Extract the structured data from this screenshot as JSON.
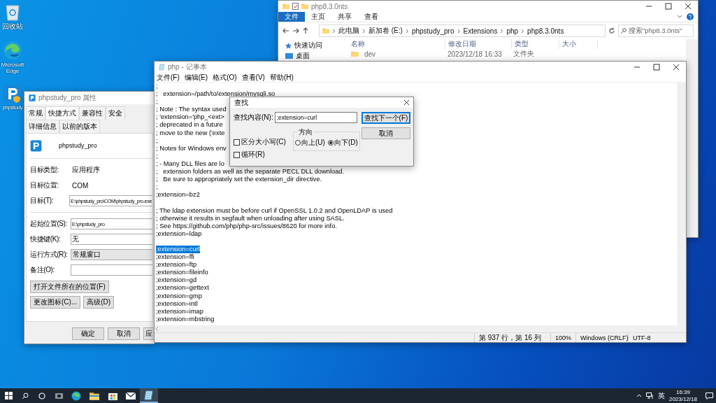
{
  "desktop_icons": [
    {
      "kind": "recycle",
      "label": "回收站"
    },
    {
      "kind": "browser",
      "label": "Microsoft Edge"
    },
    {
      "kind": "app",
      "label": "phpstudy"
    }
  ],
  "explorer": {
    "title": "php8.3.0nts",
    "ribbon_tabs": [
      {
        "label": "文件",
        "selected": true
      },
      {
        "label": "主页",
        "selected": false
      },
      {
        "label": "共享",
        "selected": false
      },
      {
        "label": "查看",
        "selected": false
      }
    ],
    "breadcrumb": [
      "此电脑",
      "新加卷 (E:)",
      "phpstudy_pro",
      "Extensions",
      "php",
      "php8.3.0nts"
    ],
    "search": {
      "placeholder": "搜索\"php8.3.0nts\""
    },
    "sidebar": [
      {
        "label": "快速访问",
        "kind": "star"
      },
      {
        "label": "桌面",
        "kind": "desktop"
      }
    ],
    "columns": [
      "名称",
      "修改日期",
      "类型",
      "大小"
    ],
    "rows": [
      {
        "name": "dev",
        "modified": "2023/12/18 16:33",
        "type": "文件夹"
      }
    ]
  },
  "properties": {
    "title": "phpstudy_pro 属性",
    "tabs": [
      {
        "label": "常规",
        "selected": false
      },
      {
        "label": "快捷方式",
        "selected": true
      },
      {
        "label": "兼容性",
        "selected": false
      },
      {
        "label": "安全",
        "selected": false
      },
      {
        "label": "详细信息",
        "selected": false
      },
      {
        "label": "以前的版本",
        "selected": false
      }
    ],
    "name": "phpstudy_pro",
    "groups": [
      [
        {
          "label": "目标类型:",
          "value": "应用程序",
          "kind": "text"
        },
        {
          "label": "目标位置:",
          "value": "COM",
          "kind": "text"
        },
        {
          "label": "目标(T):",
          "value": "E:\\phpstudy_pro\\COM\\phpstudy_pro.exe",
          "kind": "field"
        }
      ],
      [
        {
          "label": "起始位置(S):",
          "value": "E:\\phpstudy_pro",
          "kind": "field"
        },
        {
          "label": "快捷键(K):",
          "value": "无",
          "kind": "field"
        },
        {
          "label": "运行方式(R):",
          "value": "常规窗口",
          "kind": "dropdown"
        },
        {
          "label": "备注(O):",
          "kind": "field"
        }
      ]
    ],
    "actions": [
      "打开文件所在的位置(F)",
      "更改图标(C)...",
      "高级(D)"
    ],
    "footer_buttons": [
      "确定",
      "取消",
      "应"
    ]
  },
  "notepad": {
    "title": "php - 记事本",
    "menu": [
      "文件(F)",
      "编辑(E)",
      "格式(O)",
      "查看(V)",
      "帮助(H)"
    ],
    "lines": [
      {
        "text": ";",
        "selected": false
      },
      {
        "text": ";   extension=/path/to/extension/mysqli.so",
        "selected": false
      },
      {
        "text": ";",
        "selected": false
      },
      {
        "text": "; Note : The syntax used",
        "selected": false
      },
      {
        "text": "; 'extension='php_<ext>",
        "selected": false
      },
      {
        "text": "; deprecated in a future",
        "selected": false
      },
      {
        "text": "; move to the new ('exte",
        "selected": false
      },
      {
        "text": ";",
        "selected": false
      },
      {
        "text": "; Notes for Windows env",
        "selected": false
      },
      {
        "text": ";",
        "selected": false
      },
      {
        "text": "; - Many DLL files are lo",
        "selected": false
      },
      {
        "text": ";   extension folders as well as the separate PECL DLL download.",
        "selected": false
      },
      {
        "text": ";   Be sure to appropriately set the extension_dir directive.",
        "selected": false
      },
      {
        "text": ";",
        "selected": false
      },
      {
        "text": ";extension=bz2",
        "selected": false
      },
      {
        "selected": false
      },
      {
        "text": "; The ldap extension must be before curl if OpenSSL 1.0.2 and OpenLDAP is used",
        "selected": false
      },
      {
        "text": "; otherwise it results in segfault when unloading after using SASL.",
        "selected": false
      },
      {
        "text": "; See https://github.com/php/php-src/issues/8620 for more info.",
        "selected": false
      },
      {
        "text": ";extension=ldap",
        "selected": false
      },
      {
        "selected": false
      },
      {
        "text": ";extension=curl",
        "selected": true
      },
      {
        "text": ";extension=ffi",
        "selected": false
      },
      {
        "text": ";extension=ftp",
        "selected": false
      },
      {
        "text": ";extension=fileinfo",
        "selected": false
      },
      {
        "text": ";extension=gd",
        "selected": false
      },
      {
        "text": ";extension=gettext",
        "selected": false
      },
      {
        "text": ";extension=gmp",
        "selected": false
      },
      {
        "text": ";extension=intl",
        "selected": false
      },
      {
        "text": ";extension=imap",
        "selected": false
      },
      {
        "text": ";extension=mbstring",
        "selected": false
      }
    ],
    "status": [
      "第 937 行，第 16 列",
      "100%",
      "Windows (CRLF)",
      "UTF-8"
    ]
  },
  "find_dialog": {
    "title": "查找",
    "find_label": "查找内容(N):",
    "value": ";extension=curl",
    "buttons": [
      {
        "label": "查找下一个(F)",
        "default": true
      },
      {
        "label": "取消",
        "default": false
      }
    ],
    "direction": {
      "label": "方向",
      "options": [
        {
          "label": "向上(U)",
          "selected": false
        },
        {
          "label": "向下(D)",
          "selected": true
        }
      ]
    },
    "options": [
      {
        "label": "区分大小写(C)",
        "checked": false
      },
      {
        "label": "循环(R)",
        "checked": false
      }
    ]
  },
  "taskbar": {
    "apps": [
      {
        "kind": "edge",
        "active": false
      },
      {
        "kind": "folder",
        "active": false
      },
      {
        "kind": "store",
        "active": false
      },
      {
        "kind": "mail",
        "active": false
      },
      {
        "kind": "notepad",
        "active": true
      }
    ],
    "ime": "英",
    "time": "16:39",
    "date": "2023/12/18"
  }
}
